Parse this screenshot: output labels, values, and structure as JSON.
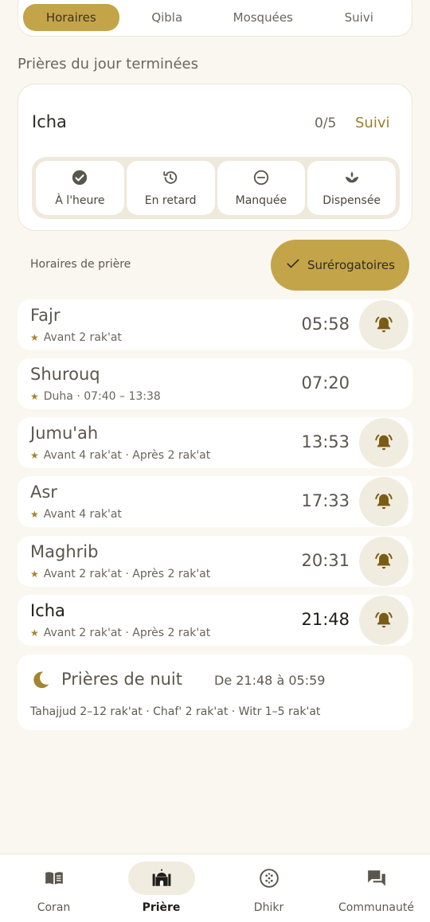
{
  "tabs": [
    {
      "label": "Horaires",
      "active": true
    },
    {
      "label": "Qibla",
      "active": false
    },
    {
      "label": "Mosquées",
      "active": false
    },
    {
      "label": "Suivi",
      "active": false
    }
  ],
  "section_title": "Prières du jour terminées",
  "status_card": {
    "prayer_name": "Icha",
    "count": "0/5",
    "suivi_label": "Suivi",
    "buttons": [
      {
        "label": "À l'heure",
        "icon": "check-circle-icon"
      },
      {
        "label": "En retard",
        "icon": "history-icon"
      },
      {
        "label": "Manquée",
        "icon": "minus-circle-icon"
      },
      {
        "label": "Dispensée",
        "icon": "lotus-icon"
      }
    ]
  },
  "horaires_label": "Horaires de prière",
  "surerogatoires_label": "Surérogatoires",
  "prayers": [
    {
      "name": "Fajr",
      "sub": "Avant 2 rak'at",
      "time": "05:58",
      "bell": true
    },
    {
      "name": "Shurouq",
      "sub": "Duha · 07:40 – 13:38",
      "time": "07:20",
      "bell": false
    },
    {
      "name": "Jumu'ah",
      "sub": "Avant 4 rak'at · Après 2 rak'at",
      "time": "13:53",
      "bell": true
    },
    {
      "name": "Asr",
      "sub": "Avant 4 rak'at",
      "time": "17:33",
      "bell": true
    },
    {
      "name": "Maghrib",
      "sub": "Avant 2 rak'at · Après 2 rak'at",
      "time": "20:31",
      "bell": true
    },
    {
      "name": "Icha",
      "sub": "Avant 2 rak'at · Après 2 rak'at",
      "time": "21:48",
      "bell": true,
      "current": true
    }
  ],
  "night": {
    "title": "Prières de nuit",
    "range": "De 21:48 à 05:59",
    "detail": "Tahajjud 2–12 rak'at · Chaf' 2 rak'at · Witr 1–5 rak'at"
  },
  "bottom_nav": [
    {
      "label": "Coran",
      "icon": "book-icon",
      "active": false
    },
    {
      "label": "Prière",
      "icon": "mosque-icon",
      "active": true
    },
    {
      "label": "Dhikr",
      "icon": "tasbih-icon",
      "active": false
    },
    {
      "label": "Communauté",
      "icon": "chat-icon",
      "active": false
    }
  ],
  "colors": {
    "accent": "#c4a449",
    "accent_dark": "#9c7f2c",
    "background": "#faf7f0",
    "card": "#ffffff"
  }
}
